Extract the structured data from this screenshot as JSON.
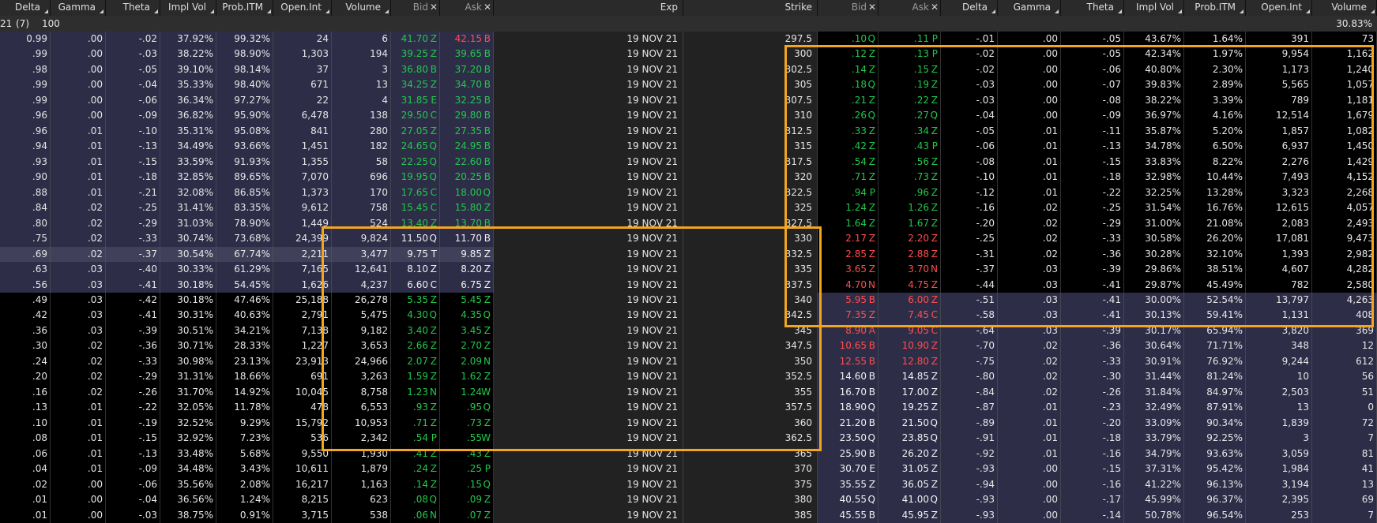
{
  "headers": [
    "Delta",
    "Gamma",
    "Theta",
    "Impl Vol",
    "Prob.ITM",
    "Open.Int",
    "Volume",
    "Bid",
    "Ask",
    "Exp",
    "Strike",
    "Bid",
    "Ask",
    "Delta",
    "Gamma",
    "Theta",
    "Impl Vol",
    "Prob.ITM",
    "Open.Int",
    "Volume"
  ],
  "subheader": {
    "a": "21",
    "b": "(7)",
    "c": "100",
    "d": "30.83%"
  },
  "colors": {
    "itm_bg": "#2d2d48",
    "atm_bg": "#40405a",
    "otm_bg": "#000000",
    "mid_bg": "#222222",
    "highlight": "#f2a51f",
    "bid_green": "#22c84a",
    "ask_red": "#ff4d4d"
  },
  "rows": [
    [
      "0.99",
      ".00",
      "-.02",
      "37.92%",
      "99.32%",
      "24",
      "6",
      "41.70",
      "Z",
      "42.15",
      "B",
      "19 NOV 21",
      "297.5",
      ".10",
      "Q",
      ".11",
      "P",
      "-.01",
      ".00",
      "-.05",
      "43.67%",
      "1.64%",
      "391",
      "73"
    ],
    [
      ".99",
      ".00",
      "-.03",
      "38.22%",
      "98.90%",
      "1,303",
      "194",
      "39.25",
      "Z",
      "39.65",
      "B",
      "19 NOV 21",
      "300",
      ".12",
      "Z",
      ".13",
      "P",
      "-.02",
      ".00",
      "-.05",
      "42.34%",
      "1.97%",
      "9,954",
      "1,162"
    ],
    [
      ".98",
      ".00",
      "-.05",
      "39.10%",
      "98.14%",
      "37",
      "3",
      "36.80",
      "B",
      "37.20",
      "B",
      "19 NOV 21",
      "302.5",
      ".14",
      "Z",
      ".15",
      "Z",
      "-.02",
      ".00",
      "-.06",
      "40.80%",
      "2.30%",
      "1,173",
      "1,240"
    ],
    [
      ".99",
      ".00",
      "-.04",
      "35.33%",
      "98.40%",
      "671",
      "13",
      "34.25",
      "Z",
      "34.70",
      "B",
      "19 NOV 21",
      "305",
      ".18",
      "Q",
      ".19",
      "Z",
      "-.03",
      ".00",
      "-.07",
      "39.83%",
      "2.89%",
      "5,565",
      "1,057"
    ],
    [
      ".99",
      ".00",
      "-.06",
      "36.34%",
      "97.27%",
      "22",
      "4",
      "31.85",
      "E",
      "32.25",
      "B",
      "19 NOV 21",
      "307.5",
      ".21",
      "Z",
      ".22",
      "Z",
      "-.03",
      ".00",
      "-.08",
      "38.22%",
      "3.39%",
      "789",
      "1,181"
    ],
    [
      ".96",
      ".00",
      "-.09",
      "36.82%",
      "95.90%",
      "6,478",
      "138",
      "29.50",
      "C",
      "29.80",
      "B",
      "19 NOV 21",
      "310",
      ".26",
      "Q",
      ".27",
      "Q",
      "-.04",
      ".00",
      "-.09",
      "36.97%",
      "4.16%",
      "12,514",
      "1,679"
    ],
    [
      ".96",
      ".01",
      "-.10",
      "35.31%",
      "95.08%",
      "841",
      "280",
      "27.05",
      "Z",
      "27.35",
      "B",
      "19 NOV 21",
      "312.5",
      ".33",
      "Z",
      ".34",
      "Z",
      "-.05",
      ".01",
      "-.11",
      "35.87%",
      "5.20%",
      "1,857",
      "1,082"
    ],
    [
      ".94",
      ".01",
      "-.13",
      "34.49%",
      "93.66%",
      "1,451",
      "182",
      "24.65",
      "Q",
      "24.95",
      "B",
      "19 NOV 21",
      "315",
      ".42",
      "Z",
      ".43",
      "P",
      "-.06",
      ".01",
      "-.13",
      "34.78%",
      "6.50%",
      "6,937",
      "1,450"
    ],
    [
      ".93",
      ".01",
      "-.15",
      "33.59%",
      "91.93%",
      "1,355",
      "58",
      "22.25",
      "Q",
      "22.60",
      "B",
      "19 NOV 21",
      "317.5",
      ".54",
      "Z",
      ".56",
      "Z",
      "-.08",
      ".01",
      "-.15",
      "33.83%",
      "8.22%",
      "2,276",
      "1,429"
    ],
    [
      ".90",
      ".01",
      "-.18",
      "32.85%",
      "89.65%",
      "7,070",
      "696",
      "19.95",
      "Q",
      "20.25",
      "B",
      "19 NOV 21",
      "320",
      ".71",
      "Z",
      ".73",
      "Z",
      "-.10",
      ".01",
      "-.18",
      "32.98%",
      "10.44%",
      "7,493",
      "4,152"
    ],
    [
      ".88",
      ".01",
      "-.21",
      "32.08%",
      "86.85%",
      "1,373",
      "170",
      "17.65",
      "C",
      "18.00",
      "Q",
      "19 NOV 21",
      "322.5",
      ".94",
      "P",
      ".96",
      "Z",
      "-.12",
      ".01",
      "-.22",
      "32.25%",
      "13.28%",
      "3,323",
      "2,268"
    ],
    [
      ".84",
      ".02",
      "-.25",
      "31.41%",
      "83.35%",
      "9,612",
      "758",
      "15.45",
      "C",
      "15.80",
      "Z",
      "19 NOV 21",
      "325",
      "1.24",
      "Z",
      "1.26",
      "Z",
      "-.16",
      ".02",
      "-.25",
      "31.54%",
      "16.76%",
      "12,615",
      "4,057"
    ],
    [
      ".80",
      ".02",
      "-.29",
      "31.03%",
      "78.90%",
      "1,449",
      "524",
      "13.40",
      "Z",
      "13.70",
      "B",
      "19 NOV 21",
      "327.5",
      "1.64",
      "Z",
      "1.67",
      "Z",
      "-.20",
      ".02",
      "-.29",
      "31.00%",
      "21.08%",
      "2,083",
      "2,493"
    ],
    [
      ".75",
      ".02",
      "-.33",
      "30.74%",
      "73.68%",
      "24,399",
      "9,824",
      "11.50",
      "Q",
      "11.70",
      "B",
      "19 NOV 21",
      "330",
      "2.17",
      "Z",
      "2.20",
      "Z",
      "-.25",
      ".02",
      "-.33",
      "30.58%",
      "26.20%",
      "17,081",
      "9,473"
    ],
    [
      ".69",
      ".02",
      "-.37",
      "30.54%",
      "67.74%",
      "2,211",
      "3,477",
      "9.75",
      "T",
      "9.85",
      "Z",
      "19 NOV 21",
      "332.5",
      "2.85",
      "Z",
      "2.88",
      "Z",
      "-.31",
      ".02",
      "-.36",
      "30.28%",
      "32.10%",
      "1,393",
      "2,982"
    ],
    [
      ".63",
      ".03",
      "-.40",
      "30.33%",
      "61.29%",
      "7,165",
      "12,641",
      "8.10",
      "Z",
      "8.20",
      "Z",
      "19 NOV 21",
      "335",
      "3.65",
      "Z",
      "3.70",
      "N",
      "-.37",
      ".03",
      "-.39",
      "29.86%",
      "38.51%",
      "4,607",
      "4,282"
    ],
    [
      ".56",
      ".03",
      "-.41",
      "30.18%",
      "54.45%",
      "1,626",
      "4,237",
      "6.60",
      "C",
      "6.75",
      "Z",
      "19 NOV 21",
      "337.5",
      "4.70",
      "N",
      "4.75",
      "Z",
      "-.44",
      ".03",
      "-.41",
      "29.87%",
      "45.49%",
      "782",
      "2,580"
    ],
    [
      ".49",
      ".03",
      "-.42",
      "30.18%",
      "47.46%",
      "25,188",
      "26,278",
      "5.35",
      "Z",
      "5.45",
      "Z",
      "19 NOV 21",
      "340",
      "5.95",
      "B",
      "6.00",
      "Z",
      "-.51",
      ".03",
      "-.41",
      "30.00%",
      "52.54%",
      "13,797",
      "4,263"
    ],
    [
      ".42",
      ".03",
      "-.41",
      "30.31%",
      "40.63%",
      "2,791",
      "5,475",
      "4.30",
      "Q",
      "4.35",
      "Q",
      "19 NOV 21",
      "342.5",
      "7.35",
      "Z",
      "7.45",
      "C",
      "-.58",
      ".03",
      "-.41",
      "30.13%",
      "59.41%",
      "1,131",
      "408"
    ],
    [
      ".36",
      ".03",
      "-.39",
      "30.51%",
      "34.21%",
      "7,138",
      "9,182",
      "3.40",
      "Z",
      "3.45",
      "Z",
      "19 NOV 21",
      "345",
      "8.90",
      "A",
      "9.05",
      "C",
      "-.64",
      ".03",
      "-.39",
      "30.17%",
      "65.94%",
      "3,820",
      "369"
    ],
    [
      ".30",
      ".02",
      "-.36",
      "30.71%",
      "28.33%",
      "1,227",
      "3,653",
      "2.66",
      "Z",
      "2.70",
      "Z",
      "19 NOV 21",
      "347.5",
      "10.65",
      "B",
      "10.90",
      "Z",
      "-.70",
      ".02",
      "-.36",
      "30.64%",
      "71.71%",
      "348",
      "12"
    ],
    [
      ".24",
      ".02",
      "-.33",
      "30.98%",
      "23.13%",
      "23,913",
      "24,966",
      "2.07",
      "Z",
      "2.09",
      "N",
      "19 NOV 21",
      "350",
      "12.55",
      "B",
      "12.80",
      "Z",
      "-.75",
      ".02",
      "-.33",
      "30.91%",
      "76.92%",
      "9,244",
      "612"
    ],
    [
      ".20",
      ".02",
      "-.29",
      "31.31%",
      "18.66%",
      "691",
      "3,263",
      "1.59",
      "Z",
      "1.62",
      "Z",
      "19 NOV 21",
      "352.5",
      "14.60",
      "B",
      "14.85",
      "Z",
      "-.80",
      ".02",
      "-.30",
      "31.44%",
      "81.24%",
      "10",
      "56"
    ],
    [
      ".16",
      ".02",
      "-.26",
      "31.70%",
      "14.92%",
      "10,045",
      "8,758",
      "1.23",
      "N",
      "1.24",
      "W",
      "19 NOV 21",
      "355",
      "16.70",
      "B",
      "17.00",
      "Z",
      "-.84",
      ".02",
      "-.26",
      "31.84%",
      "84.97%",
      "2,503",
      "51"
    ],
    [
      ".13",
      ".01",
      "-.22",
      "32.05%",
      "11.78%",
      "478",
      "6,553",
      ".93",
      "Z",
      ".95",
      "Q",
      "19 NOV 21",
      "357.5",
      "18.90",
      "Q",
      "19.25",
      "Z",
      "-.87",
      ".01",
      "-.23",
      "32.49%",
      "87.91%",
      "13",
      "0"
    ],
    [
      ".10",
      ".01",
      "-.19",
      "32.52%",
      "9.29%",
      "15,792",
      "10,953",
      ".71",
      "Z",
      ".73",
      "Z",
      "19 NOV 21",
      "360",
      "21.20",
      "B",
      "21.50",
      "Q",
      "-.89",
      ".01",
      "-.20",
      "33.09%",
      "90.34%",
      "1,839",
      "72"
    ],
    [
      ".08",
      ".01",
      "-.15",
      "32.92%",
      "7.23%",
      "536",
      "2,342",
      ".54",
      "P",
      ".55",
      "W",
      "19 NOV 21",
      "362.5",
      "23.50",
      "Q",
      "23.85",
      "Q",
      "-.91",
      ".01",
      "-.18",
      "33.79%",
      "92.25%",
      "3",
      "7"
    ],
    [
      ".06",
      ".01",
      "-.13",
      "33.48%",
      "5.68%",
      "9,550",
      "1,930",
      ".41",
      "Z",
      ".43",
      "Z",
      "19 NOV 21",
      "365",
      "25.90",
      "B",
      "26.20",
      "Z",
      "-.92",
      ".01",
      "-.16",
      "34.79%",
      "93.63%",
      "3,059",
      "81"
    ],
    [
      ".04",
      ".01",
      "-.09",
      "34.48%",
      "3.43%",
      "10,611",
      "1,879",
      ".24",
      "Z",
      ".25",
      "P",
      "19 NOV 21",
      "370",
      "30.70",
      "E",
      "31.05",
      "Z",
      "-.93",
      ".00",
      "-.15",
      "37.31%",
      "95.42%",
      "1,984",
      "41"
    ],
    [
      ".02",
      ".00",
      "-.06",
      "35.56%",
      "2.08%",
      "16,217",
      "1,163",
      ".14",
      "Z",
      ".15",
      "Q",
      "19 NOV 21",
      "375",
      "35.55",
      "Z",
      "36.05",
      "Z",
      "-.94",
      ".00",
      "-.16",
      "41.22%",
      "96.13%",
      "3,194",
      "13"
    ],
    [
      ".01",
      ".00",
      "-.04",
      "36.56%",
      "1.24%",
      "8,215",
      "623",
      ".08",
      "Q",
      ".09",
      "Z",
      "19 NOV 21",
      "380",
      "40.55",
      "Q",
      "41.00",
      "Q",
      "-.93",
      ".00",
      "-.17",
      "45.99%",
      "96.37%",
      "2,395",
      "69"
    ],
    [
      ".01",
      ".00",
      "-.03",
      "38.75%",
      "0.91%",
      "3,715",
      "538",
      ".06",
      "N",
      ".07",
      "Z",
      "19 NOV 21",
      "385",
      "45.55",
      "B",
      "45.95",
      "Z",
      "-.93",
      ".00",
      "-.14",
      "50.78%",
      "96.54%",
      "253",
      "7"
    ]
  ]
}
